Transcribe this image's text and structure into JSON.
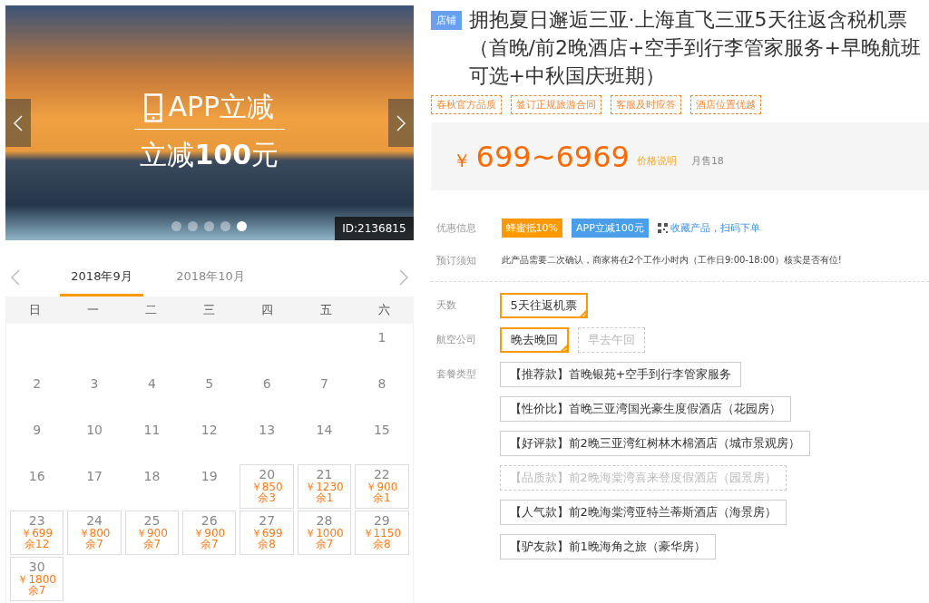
{
  "hero": {
    "headline": "APP立减",
    "subline": "立减**100**元",
    "id_label": "ID:2136815",
    "dots": [
      {
        "selected": false
      },
      {
        "selected": false
      },
      {
        "selected": false
      },
      {
        "selected": false
      },
      {
        "selected": true
      }
    ]
  },
  "calendar": {
    "tabs": [
      {
        "label": "2018年9月",
        "selected": true
      },
      {
        "label": "2018年10月",
        "selected": false
      }
    ],
    "weekdays": [
      "日",
      "一",
      "二",
      "三",
      "四",
      "五",
      "六"
    ],
    "days": [
      {
        "kind": "blank"
      },
      {
        "kind": "blank"
      },
      {
        "kind": "blank"
      },
      {
        "kind": "blank"
      },
      {
        "kind": "blank"
      },
      {
        "kind": "blank"
      },
      {
        "kind": "plain",
        "day": "1"
      },
      {
        "kind": "plain",
        "day": "2"
      },
      {
        "kind": "plain",
        "day": "3"
      },
      {
        "kind": "plain",
        "day": "4"
      },
      {
        "kind": "plain",
        "day": "5"
      },
      {
        "kind": "plain",
        "day": "6"
      },
      {
        "kind": "plain",
        "day": "7"
      },
      {
        "kind": "plain",
        "day": "8"
      },
      {
        "kind": "plain",
        "day": "9"
      },
      {
        "kind": "plain",
        "day": "10"
      },
      {
        "kind": "plain",
        "day": "11"
      },
      {
        "kind": "plain",
        "day": "12"
      },
      {
        "kind": "plain",
        "day": "13"
      },
      {
        "kind": "plain",
        "day": "14"
      },
      {
        "kind": "plain",
        "day": "15"
      },
      {
        "kind": "plain",
        "day": "16"
      },
      {
        "kind": "plain",
        "day": "17"
      },
      {
        "kind": "plain",
        "day": "18"
      },
      {
        "kind": "plain",
        "day": "19"
      },
      {
        "kind": "priced",
        "day": "20",
        "price": "￥850",
        "remain": "余3"
      },
      {
        "kind": "priced",
        "day": "21",
        "price": "￥1230",
        "remain": "余1"
      },
      {
        "kind": "priced",
        "day": "22",
        "price": "￥900",
        "remain": "余1"
      },
      {
        "kind": "priced",
        "day": "23",
        "price": "￥699",
        "remain": "余12"
      },
      {
        "kind": "priced",
        "day": "24",
        "price": "￥800",
        "remain": "余7"
      },
      {
        "kind": "priced",
        "day": "25",
        "price": "￥900",
        "remain": "余7"
      },
      {
        "kind": "priced",
        "day": "26",
        "price": "￥900",
        "remain": "余7"
      },
      {
        "kind": "priced",
        "day": "27",
        "price": "￥699",
        "remain": "余8"
      },
      {
        "kind": "priced",
        "day": "28",
        "price": "￥1000",
        "remain": "余7"
      },
      {
        "kind": "priced",
        "day": "29",
        "price": "￥1150",
        "remain": "余8"
      },
      {
        "kind": "priced",
        "day": "30",
        "price": "￥1800",
        "remain": "余7"
      }
    ]
  },
  "product": {
    "shop_badge": "店铺",
    "title": "拥抱夏日邂逅三亚·上海直飞三亚5天往返含税机票（首晚/前2晚酒店+空手到行李管家服务+早晚航班可选+中秋国庆班期）",
    "tags": [
      "春秋官方品质",
      "签订正规旅游合同",
      "客服及时应答",
      "酒店位置优越"
    ],
    "price": {
      "currency": "￥",
      "range": "699~6969",
      "note": "价格说明",
      "monthly_sales": "月售18"
    },
    "promo": {
      "label": "优惠信息",
      "badges": [
        {
          "text": "蜂蜜抵10%",
          "color": "#ff9900"
        },
        {
          "text": "APP立减100元",
          "color": "#4a9eea"
        }
      ],
      "qr_link": "收藏产品，扫码下单"
    },
    "notice": {
      "label": "预订须知",
      "text": "此产品需要二次确认，商家将在2个工作小时内（工作日9:00-18:00）核实是否有位!"
    },
    "option_groups": [
      {
        "label": "天数",
        "options": [
          {
            "text": "5天往返机票",
            "selected": true,
            "disabled": false
          }
        ]
      },
      {
        "label": "航空公司",
        "options": [
          {
            "text": "晚去晚回",
            "selected": true,
            "disabled": false
          },
          {
            "text": "早去午回",
            "selected": false,
            "disabled": true
          }
        ]
      },
      {
        "label": "套餐类型",
        "options": [
          {
            "text": "【推荐款】首晚银苑+空手到行李管家服务",
            "selected": false,
            "disabled": false
          },
          {
            "text": "【性价比】首晚三亚湾国光豪生度假酒店（花园房）",
            "selected": false,
            "disabled": false
          },
          {
            "text": "【好评款】前2晚三亚湾红树林木棉酒店（城市景观房）",
            "selected": false,
            "disabled": false
          },
          {
            "text": "【品质款】前2晚海棠湾喜来登度假酒店（园景房）",
            "selected": false,
            "disabled": true
          },
          {
            "text": "【人气款】前2晚海棠湾亚特兰蒂斯酒店（海景房）",
            "selected": false,
            "disabled": false
          },
          {
            "text": "【驴友款】前1晚海角之旅（豪华房）",
            "selected": false,
            "disabled": false
          }
        ]
      }
    ]
  }
}
